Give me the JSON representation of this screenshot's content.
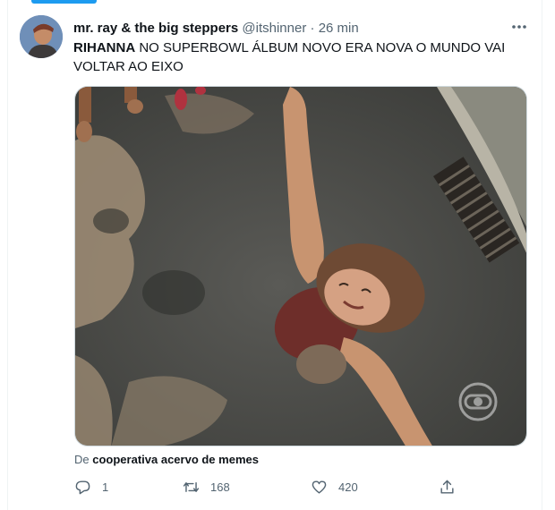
{
  "tweet": {
    "author_name": "mr. ray & the big steppers",
    "handle": "@itshinner",
    "separator": "·",
    "time": "26 min",
    "text_bold": "RIHANNA",
    "text_rest": " NO SUPERBOWL ÁLBUM NOVO ERA NOVA O MUNDO VAI VOLTAR AO EIXO"
  },
  "attribution": {
    "prefix": "De",
    "source": "cooperativa acervo de memes"
  },
  "actions": {
    "replies": "1",
    "retweets": "168",
    "likes": "420"
  },
  "icons": {
    "more": "more-horizontal-icon",
    "reply": "reply-icon",
    "retweet": "retweet-icon",
    "like": "heart-icon",
    "share": "share-icon",
    "watermark": "globo-logo-icon"
  },
  "colors": {
    "accent": "#1d9bf0",
    "secondary_text": "#536471",
    "primary_text": "#0f1419"
  }
}
